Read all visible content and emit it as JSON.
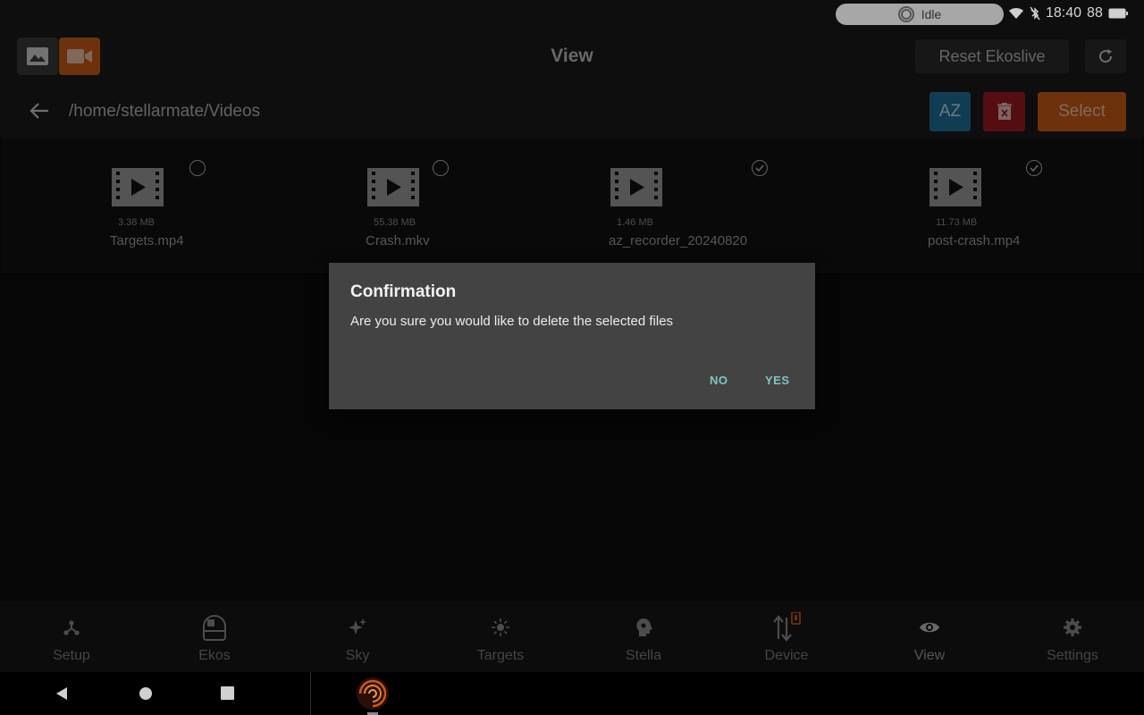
{
  "status": {
    "state_label": "Idle",
    "time": "18:40",
    "battery": "88"
  },
  "header": {
    "title": "View",
    "reset_label": "Reset Ekoslive"
  },
  "toolbar": {
    "path": "/home/stellarmate/Videos",
    "sort_label": "AZ",
    "select_label": "Select"
  },
  "files": [
    {
      "name": "Targets.mp4",
      "size": "3.38 MB",
      "selected": false
    },
    {
      "name": "Crash.mkv",
      "size": "55.38 MB",
      "selected": false
    },
    {
      "name": "az_recorder_20240820",
      "size": "1.46 MB",
      "selected": true
    },
    {
      "name": "post-crash.mp4",
      "size": "11.73 MB",
      "selected": true
    }
  ],
  "dialog": {
    "title": "Confirmation",
    "message": "Are you sure you would like to delete the selected files",
    "no_label": "NO",
    "yes_label": "YES"
  },
  "nav": [
    {
      "label": "Setup",
      "icon": "setup-icon"
    },
    {
      "label": "Ekos",
      "icon": "ekos-icon"
    },
    {
      "label": "Sky",
      "icon": "sky-icon"
    },
    {
      "label": "Targets",
      "icon": "targets-icon"
    },
    {
      "label": "Stella",
      "icon": "stella-icon"
    },
    {
      "label": "Device",
      "icon": "device-icon"
    },
    {
      "label": "View",
      "icon": "view-icon"
    },
    {
      "label": "Settings",
      "icon": "settings-icon"
    }
  ],
  "colors": {
    "accent_orange": "#c65a14",
    "sort_blue": "#1f6f9a",
    "delete_red": "#9a1a20",
    "dialog_button": "#7fc4c0"
  }
}
